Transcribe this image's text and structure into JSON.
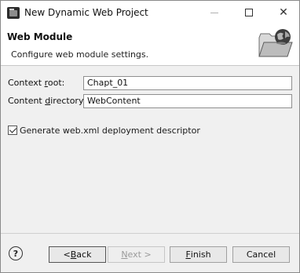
{
  "window": {
    "title": "New Dynamic Web Project",
    "close_glyph": "✕"
  },
  "banner": {
    "title": "Web Module",
    "description": "Configure web module settings.",
    "icon": "web-project-folder-icon"
  },
  "form": {
    "context_root_label_pre": "Context ",
    "context_root_label_mnemonic": "r",
    "context_root_label_post": "oot:",
    "context_root_value": "Chapt_01",
    "content_dir_label_pre": "Content ",
    "content_dir_label_mnemonic": "d",
    "content_dir_label_post": "irectory:",
    "content_dir_value": "WebContent",
    "generate_descriptor_label": "Generate web.xml deployment descriptor",
    "generate_descriptor_checked": true
  },
  "footer": {
    "help_glyph": "?",
    "back_label_pre": "< ",
    "back_label_mnemonic": "B",
    "back_label_post": "ack",
    "next_label_pre": "",
    "next_label_mnemonic": "N",
    "next_label_post": "ext >",
    "finish_label_pre": "",
    "finish_label_mnemonic": "F",
    "finish_label_post": "inish",
    "cancel_label": "Cancel"
  }
}
